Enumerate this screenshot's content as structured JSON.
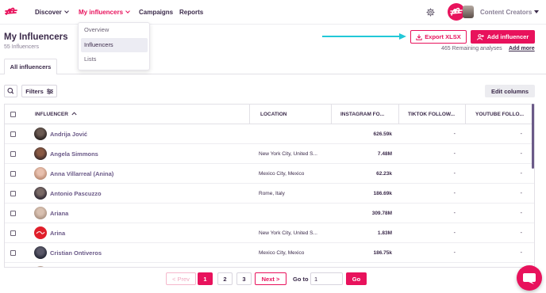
{
  "colors": {
    "accent": "#e8125c",
    "text": "#3b2a4a",
    "muted": "#8a8096",
    "arrow": "#22c8d8"
  },
  "nav": {
    "items": [
      {
        "label": "Discover",
        "has_chevron": true
      },
      {
        "label": "My influencers",
        "has_chevron": true,
        "active": true
      },
      {
        "label": "Campaigns"
      },
      {
        "label": "Reports"
      }
    ],
    "account_label": "Content Creators",
    "icons": [
      "settings-icon",
      "brand-logo-icon"
    ]
  },
  "dropdown": {
    "items": [
      {
        "label": "Overview"
      },
      {
        "label": "Influencers",
        "active": true
      },
      {
        "label": "Lists"
      }
    ]
  },
  "header": {
    "title": "My Influencers",
    "subtitle": "55 Influencers",
    "export_label": "Export XLSX",
    "add_label": "Add influencer",
    "remaining_text": "465 Remaining analyses",
    "add_more_label": "Add more"
  },
  "tabs": [
    {
      "label": "All influencers"
    }
  ],
  "toolbar": {
    "filters_label": "Filters",
    "edit_columns_label": "Edit columns"
  },
  "table": {
    "columns": [
      "INFLUENCER",
      "LOCATION",
      "INSTAGRAM FO...",
      "TIKTOK FOLLOW...",
      "YOUTUBE FOLLO..."
    ],
    "sort_column": "INFLUENCER",
    "rows": [
      {
        "name": "Andrija Jović",
        "location": "",
        "instagram": "626.59k",
        "tiktok": "-",
        "youtube": "-"
      },
      {
        "name": "Angela Simmons",
        "location": "New York City, United S...",
        "instagram": "7.48M",
        "tiktok": "-",
        "youtube": "-"
      },
      {
        "name": "Anna Villarreal (Anina)",
        "location": "Mexico City, Mexico",
        "instagram": "62.23k",
        "tiktok": "-",
        "youtube": "-"
      },
      {
        "name": "Antonio Pascuzzo",
        "location": "Rome, Italy",
        "instagram": "186.69k",
        "tiktok": "-",
        "youtube": "-"
      },
      {
        "name": "Ariana",
        "location": "",
        "instagram": "309.78M",
        "tiktok": "-",
        "youtube": "-"
      },
      {
        "name": "Arina",
        "location": "New York City, United S...",
        "instagram": "1.83M",
        "tiktok": "-",
        "youtube": "-"
      },
      {
        "name": "Cristian Ontiveros",
        "location": "Mexico City, Mexico",
        "instagram": "186.75k",
        "tiktok": "-",
        "youtube": "-"
      }
    ]
  },
  "pagination": {
    "prev_label": "< Prev",
    "pages": [
      "1",
      "2",
      "3"
    ],
    "current_page": "1",
    "next_label": "Next >",
    "goto_label": "Go to",
    "goto_value": "1",
    "go_label": "Go"
  }
}
